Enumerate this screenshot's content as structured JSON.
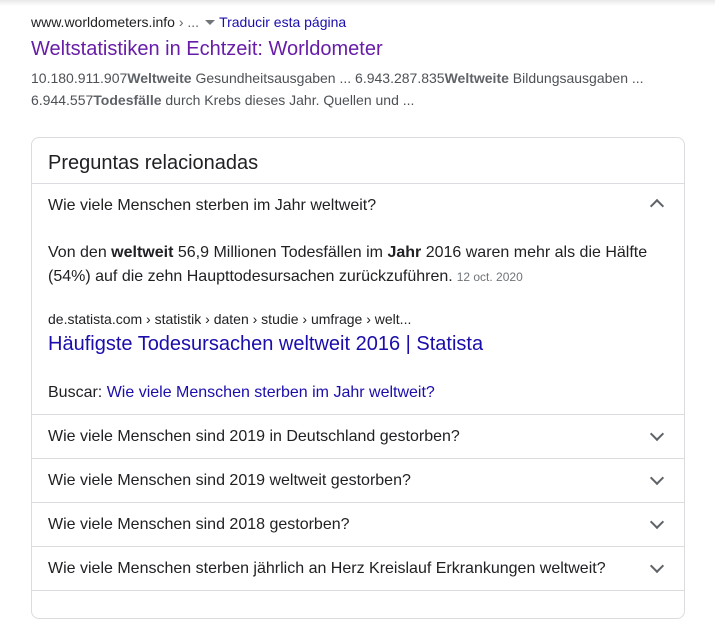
{
  "result": {
    "cite_host": "www.worldometers.info",
    "cite_sep": " › ...",
    "translate": "Traducir esta página",
    "title": "Weltstatistiken in Echtzeit: Worldometer",
    "snippet": {
      "p1": "10.180.911.907",
      "b1": "Weltweite",
      "p2": " Gesundheitsausgaben ... 6.943.287.835",
      "b2": "Weltweite",
      "p3": " Bildungsausgaben ... 6.944.557",
      "b3": "Todesfälle",
      "p4": " durch Krebs dieses Jahr. Quellen und ..."
    }
  },
  "paa": {
    "title": "Preguntas relacionadas",
    "expanded": {
      "question": "Wie viele Menschen sterben im Jahr weltweit?",
      "answer": {
        "t1": "Von den ",
        "b1": "weltweit",
        "t2": " 56,9 Millionen Todesfällen im ",
        "b2": "Jahr",
        "t3": " 2016 waren mehr als die Hälfte (54%) auf die zehn Haupttodesursachen zurückzuführen.",
        "date": "12 oct. 2020"
      },
      "cite": "de.statista.com › statistik › daten › studie › umfrage › welt...",
      "link": "Häufigste Todesursachen weltweit 2016 | Statista",
      "search_label": "Buscar: ",
      "search_link": "Wie viele Menschen sterben im Jahr weltweit?"
    },
    "questions": [
      "Wie viele Menschen sind 2019 in Deutschland gestorben?",
      "Wie viele Menschen sind 2019 weltweit gestorben?",
      "Wie viele Menschen sind 2018 gestorben?",
      "Wie viele Menschen sterben jährlich an Herz Kreislauf Erkrankungen weltweit?"
    ]
  }
}
